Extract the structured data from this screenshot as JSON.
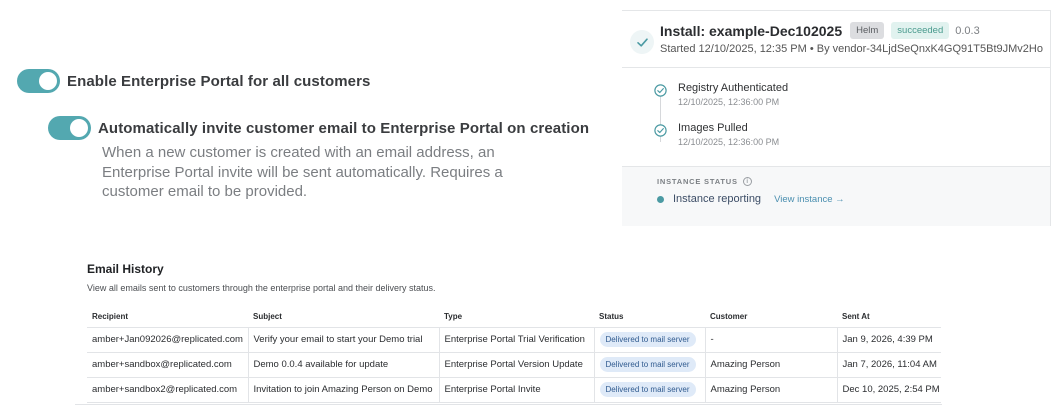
{
  "settings": {
    "enable_portal_label": "Enable Enterprise Portal for all customers",
    "enable_portal_on": true,
    "auto_invite_label": "Automatically invite customer email to Enterprise Portal on creation",
    "auto_invite_on": true,
    "auto_invite_description": "When a new customer is created with an email address, an Enterprise Portal invite will be sent automatically. Requires a customer email to be provided."
  },
  "install": {
    "title": "Install: example-Dec102025",
    "helm_badge": "Helm",
    "status_badge": "succeeded",
    "version": "0.0.3",
    "started": "Started 12/10/2025, 12:35 PM • By vendor-34LjdSeQnxK4GQ91T5Bt9JMv2Ho",
    "steps": [
      {
        "title": "Registry Authenticated",
        "time": "12/10/2025, 12:36:00 PM"
      },
      {
        "title": "Images Pulled",
        "time": "12/10/2025, 12:36:00 PM"
      }
    ],
    "instance_status_heading": "INSTANCE STATUS",
    "instance_status": "Instance reporting",
    "view_instance_link": "View instance →",
    "colors": {
      "accent": "#4b9aa3",
      "succeeded_bg": "#e1f2ef"
    }
  },
  "email_history": {
    "title": "Email History",
    "subtitle": "View all emails sent to customers through the enterprise portal and their delivery status.",
    "columns": [
      "Recipient",
      "Subject",
      "Type",
      "Status",
      "Customer",
      "Sent At"
    ],
    "rows": [
      [
        "amber+Jan092026@replicated.com",
        "Verify your email to start your Demo trial",
        "Enterprise Portal Trial Verification",
        "Delivered to mail server",
        "-",
        "Jan 9, 2026, 4:39 PM"
      ],
      [
        "amber+sandbox@replicated.com",
        "Demo 0.0.4 available for update",
        "Enterprise Portal Version Update",
        "Delivered to mail server",
        "Amazing Person",
        "Jan 7, 2026, 11:04 AM"
      ],
      [
        "amber+sandbox2@replicated.com",
        "Invitation to join Amazing Person on Demo",
        "Enterprise Portal Invite",
        "Delivered to mail server",
        "Amazing Person",
        "Dec 10, 2025, 2:54 PM"
      ]
    ]
  }
}
